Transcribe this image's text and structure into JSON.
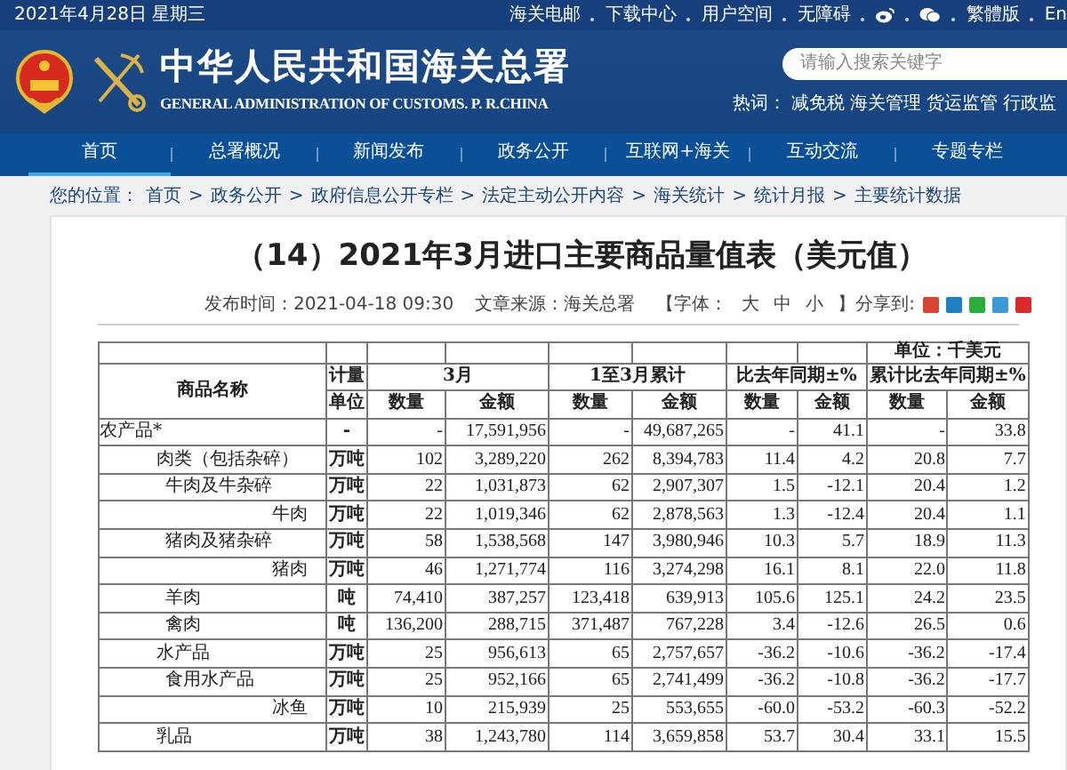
{
  "top_bar": {
    "date": "2021年4月28日 星期三",
    "links": [
      {
        "kind": "text",
        "label": "海关电邮"
      },
      {
        "kind": "text",
        "label": "下载中心"
      },
      {
        "kind": "text",
        "label": "用户空间"
      },
      {
        "kind": "text",
        "label": "无障碍"
      },
      {
        "kind": "weibo"
      },
      {
        "kind": "wechat"
      },
      {
        "kind": "text",
        "label": "繁體版"
      },
      {
        "kind": "text",
        "label": "En"
      }
    ]
  },
  "header": {
    "title": "中华人民共和国海关总署",
    "subtitle": "GENERAL ADMINISTRATION OF CUSTOMS. P. R.CHINA",
    "search": {
      "placeholder": "请输入搜索关键字"
    },
    "hot_label": "热词：",
    "hot_words": [
      "减免税",
      "海关管理",
      "货运监管",
      "行政监"
    ]
  },
  "nav": [
    {
      "label": "首页",
      "selected": true
    },
    {
      "label": "总署概况",
      "selected": false
    },
    {
      "label": "新闻发布",
      "selected": false
    },
    {
      "label": "政务公开",
      "selected": false
    },
    {
      "label": "互联网+海关",
      "selected": false
    },
    {
      "label": "互动交流",
      "selected": false
    },
    {
      "label": "专题专栏",
      "selected": false
    }
  ],
  "breadcrumb": {
    "label": "您的位置：",
    "separator": ">",
    "items": [
      "首页",
      "政务公开",
      "政府信息公开专栏",
      "法定主动公开内容",
      "海关统计",
      "统计月报",
      "主要统计数据"
    ]
  },
  "article": {
    "title": "（14）2021年3月进口主要商品量值表（美元值）",
    "published": "发布时间：2021-04-18 09:30",
    "source": "文章来源：海关总署",
    "font_label": "【字体：",
    "font_sizes": [
      "大",
      "中",
      "小"
    ],
    "font_end": "】",
    "share_label": "分享到:",
    "share": [
      {
        "color": "#d9432f"
      },
      {
        "color": "#1d7fc4"
      },
      {
        "color": "#2aae3a"
      },
      {
        "color": "#3a9ad9"
      },
      {
        "color": "#d92b2b"
      }
    ]
  },
  "table": {
    "unit_note": "单位：千美元",
    "head": {
      "name": "商品名称",
      "unit_top": "计量",
      "unit_bottom": "单位",
      "groups": [
        "3月",
        "1至3月累计",
        "比去年同期±%",
        "累计比去年同期±%"
      ],
      "sub": [
        "数量",
        "金额",
        "数量",
        "金额",
        "数量",
        "金额",
        "数量",
        "金额"
      ]
    },
    "rows": [
      {
        "name": "农产品*",
        "unit": "-",
        "values": [
          "-",
          "17,591,956",
          "-",
          "49,687,265",
          "-",
          "41.1",
          "-",
          "33.8"
        ],
        "children": [
          {
            "name": "肉类（包括杂碎）",
            "unit": "万吨",
            "values": [
              "102",
              "3,289,220",
              "262",
              "8,394,783",
              "11.4",
              "4.2",
              "20.8",
              "7.7"
            ],
            "children": [
              {
                "name": "牛肉及牛杂碎",
                "unit": "万吨",
                "values": [
                  "22",
                  "1,031,873",
                  "62",
                  "2,907,307",
                  "1.5",
                  "-12.1",
                  "20.4",
                  "1.2"
                ],
                "children": [
                  {
                    "name": "牛肉",
                    "unit": "万吨",
                    "values": [
                      "22",
                      "1,019,346",
                      "62",
                      "2,878,563",
                      "1.3",
                      "-12.4",
                      "20.4",
                      "1.1"
                    ]
                  }
                ]
              },
              {
                "name": "猪肉及猪杂碎",
                "unit": "万吨",
                "values": [
                  "58",
                  "1,538,568",
                  "147",
                  "3,980,946",
                  "10.3",
                  "5.7",
                  "18.9",
                  "11.3"
                ],
                "children": [
                  {
                    "name": "猪肉",
                    "unit": "万吨",
                    "values": [
                      "46",
                      "1,271,774",
                      "116",
                      "3,274,298",
                      "16.1",
                      "8.1",
                      "22.0",
                      "11.8"
                    ]
                  }
                ]
              },
              {
                "name": "羊肉",
                "unit": "吨",
                "values": [
                  "74,410",
                  "387,257",
                  "123,418",
                  "639,913",
                  "105.6",
                  "125.1",
                  "24.2",
                  "23.5"
                ]
              },
              {
                "name": "禽肉",
                "unit": "吨",
                "values": [
                  "136,200",
                  "288,715",
                  "371,487",
                  "767,228",
                  "3.4",
                  "-12.6",
                  "26.5",
                  "0.6"
                ]
              }
            ]
          },
          {
            "name": "水产品",
            "unit": "万吨",
            "values": [
              "25",
              "956,613",
              "65",
              "2,757,657",
              "-36.2",
              "-10.6",
              "-36.2",
              "-17.4"
            ],
            "children": [
              {
                "name": "食用水产品",
                "unit": "万吨",
                "values": [
                  "25",
                  "952,166",
                  "65",
                  "2,741,499",
                  "-36.2",
                  "-10.8",
                  "-36.2",
                  "-17.7"
                ],
                "children": [
                  {
                    "name": "冰鱼",
                    "unit": "万吨",
                    "values": [
                      "10",
                      "215,939",
                      "25",
                      "553,655",
                      "-60.0",
                      "-53.2",
                      "-60.3",
                      "-52.2"
                    ]
                  }
                ]
              }
            ]
          },
          {
            "name": "乳品",
            "unit": "万吨",
            "values": [
              "38",
              "1,243,780",
              "114",
              "3,659,858",
              "53.7",
              "30.4",
              "33.1",
              "15.5"
            ]
          }
        ]
      }
    ]
  }
}
